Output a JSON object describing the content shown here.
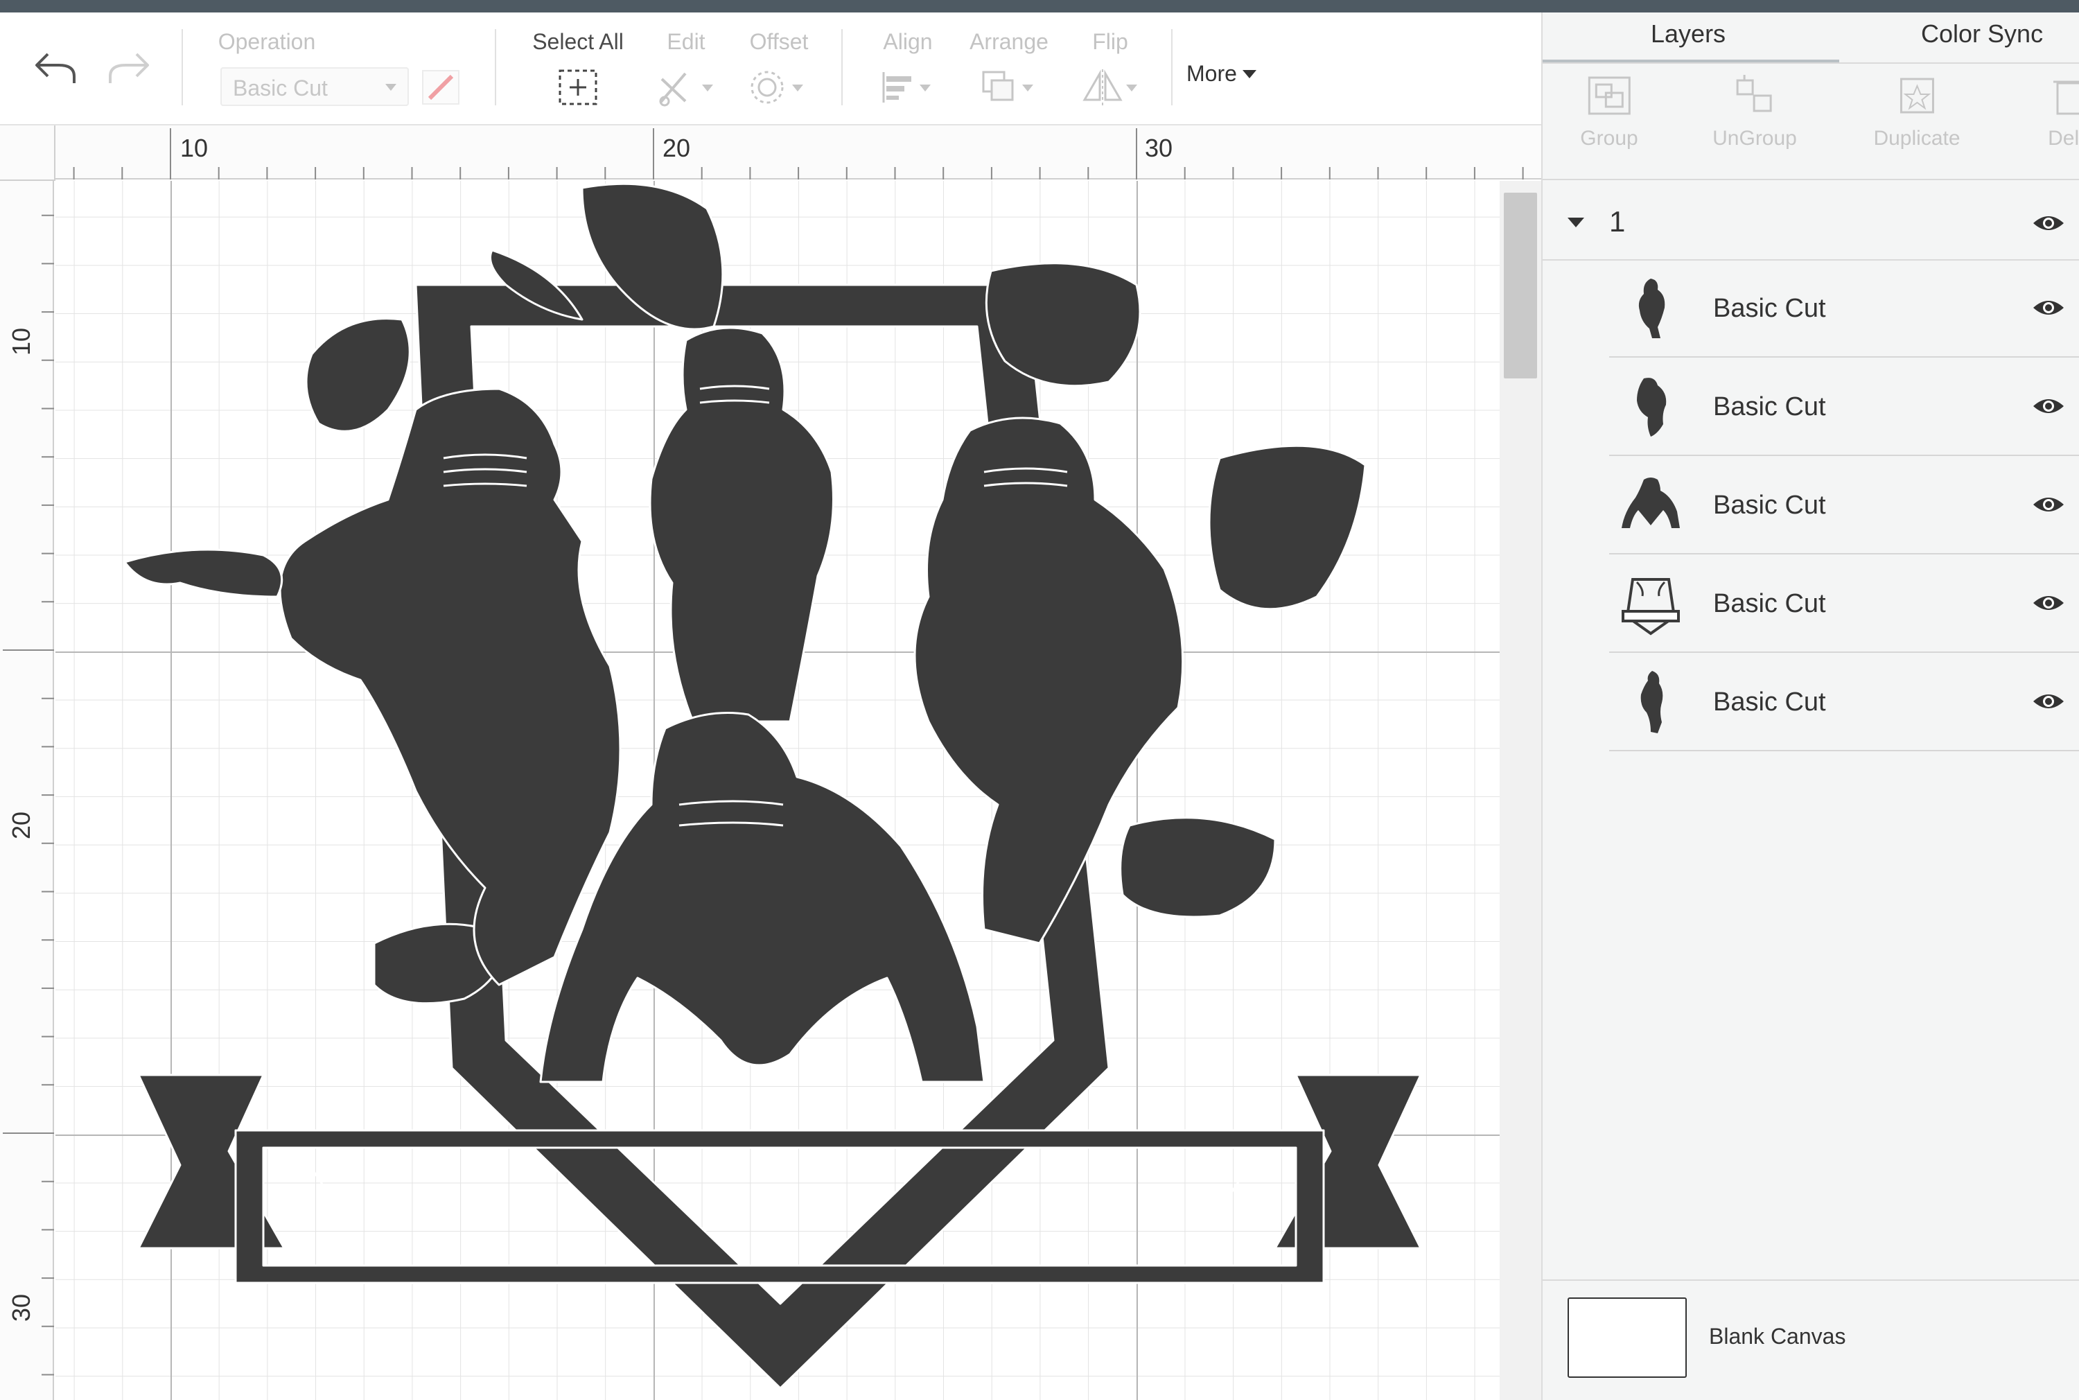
{
  "toolbar": {
    "undo_icon": "undo-icon",
    "redo_icon": "redo-icon",
    "operation_label": "Operation",
    "operation_value": "Basic Cut",
    "pen_icon": "pen-icon",
    "select_all_label": "Select All",
    "edit_label": "Edit",
    "offset_label": "Offset",
    "align_label": "Align",
    "arrange_label": "Arrange",
    "flip_label": "Flip",
    "more_label": "More"
  },
  "rulers": {
    "horizontal": [
      "10",
      "20",
      "30"
    ],
    "vertical": [
      "10",
      "20",
      "30"
    ]
  },
  "panel": {
    "tabs": [
      "Layers",
      "Color Sync"
    ],
    "active_tab": "Layers",
    "tools": [
      {
        "label": "Group",
        "icon": "group-icon"
      },
      {
        "label": "UnGroup",
        "icon": "ungroup-icon"
      },
      {
        "label": "Duplicate",
        "icon": "duplicate-icon"
      },
      {
        "label": "Dele",
        "icon": "delete-icon"
      }
    ],
    "group_name": "1",
    "layers": [
      {
        "name": "Basic Cut",
        "thumb": "player-running-thumbnail"
      },
      {
        "name": "Basic Cut",
        "thumb": "player-catching-thumbnail"
      },
      {
        "name": "Basic Cut",
        "thumb": "player-crouching-thumbnail"
      },
      {
        "name": "Basic Cut",
        "thumb": "shield-banner-thumbnail"
      },
      {
        "name": "Basic Cut",
        "thumb": "player-throwing-thumbnail"
      }
    ],
    "blank_canvas_label": "Blank Canvas"
  },
  "colors": {
    "design_fill": "#3b3b3b",
    "topbar": "#4e5a63",
    "panel_bg": "#f4f5f5",
    "disabled_text": "#c3c3c3"
  }
}
